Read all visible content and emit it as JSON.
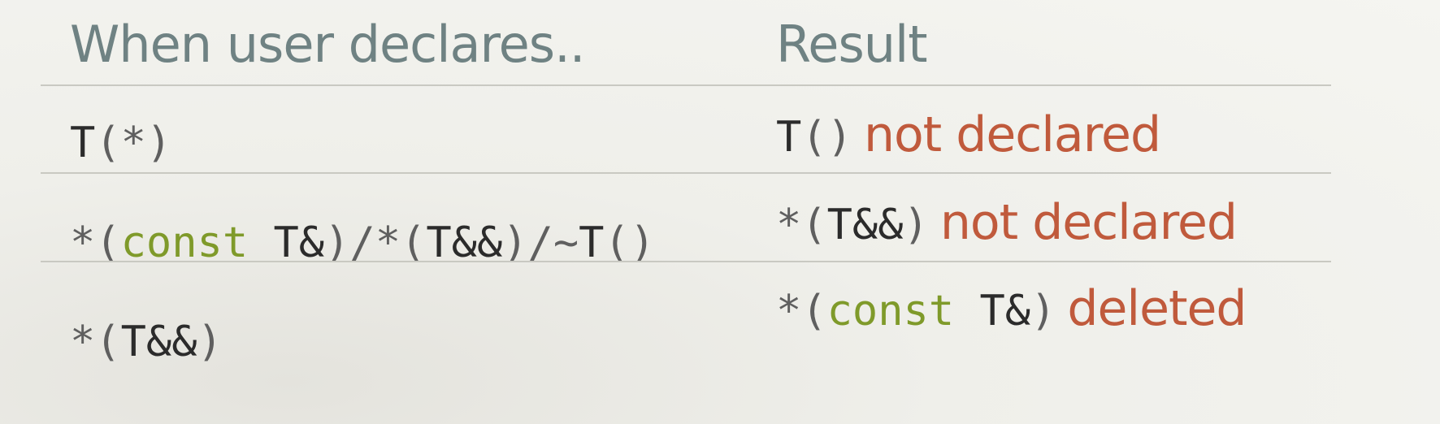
{
  "table": {
    "headers": {
      "when": "When user declares..",
      "result": "Result"
    },
    "rows": [
      {
        "declares": [
          {
            "text": "T",
            "style": "t"
          },
          {
            "text": "(*)",
            "style": "p"
          }
        ],
        "result_code": [
          {
            "text": "T",
            "style": "t"
          },
          {
            "text": "()",
            "style": "p"
          }
        ],
        "result_status": "not declared"
      },
      {
        "declares": [
          {
            "text": "*(",
            "style": "p"
          },
          {
            "text": "const",
            "style": "kw"
          },
          {
            "text": " T&",
            "style": "t"
          },
          {
            "text": ")/*(",
            "style": "p"
          },
          {
            "text": "T&&",
            "style": "t"
          },
          {
            "text": ")/~",
            "style": "p"
          },
          {
            "text": "T",
            "style": "t"
          },
          {
            "text": "()",
            "style": "p"
          }
        ],
        "result_code": [
          {
            "text": "*(",
            "style": "p"
          },
          {
            "text": "T&&",
            "style": "t"
          },
          {
            "text": ")",
            "style": "p"
          }
        ],
        "result_status": "not declared"
      },
      {
        "declares": [
          {
            "text": "*(",
            "style": "p"
          },
          {
            "text": "T&&",
            "style": "t"
          },
          {
            "text": ")",
            "style": "p"
          }
        ],
        "result_code": [
          {
            "text": "*(",
            "style": "p"
          },
          {
            "text": "const",
            "style": "kw"
          },
          {
            "text": " T&",
            "style": "t"
          },
          {
            "text": ")",
            "style": "p"
          }
        ],
        "result_status": "deleted"
      }
    ]
  },
  "colors": {
    "header": "#6f8283",
    "keyword": "#7f9a2a",
    "status": "#c05a3c",
    "type": "#2b2b2b",
    "punctuation": "#5f5f5f",
    "rule": "#c9c9c2"
  }
}
